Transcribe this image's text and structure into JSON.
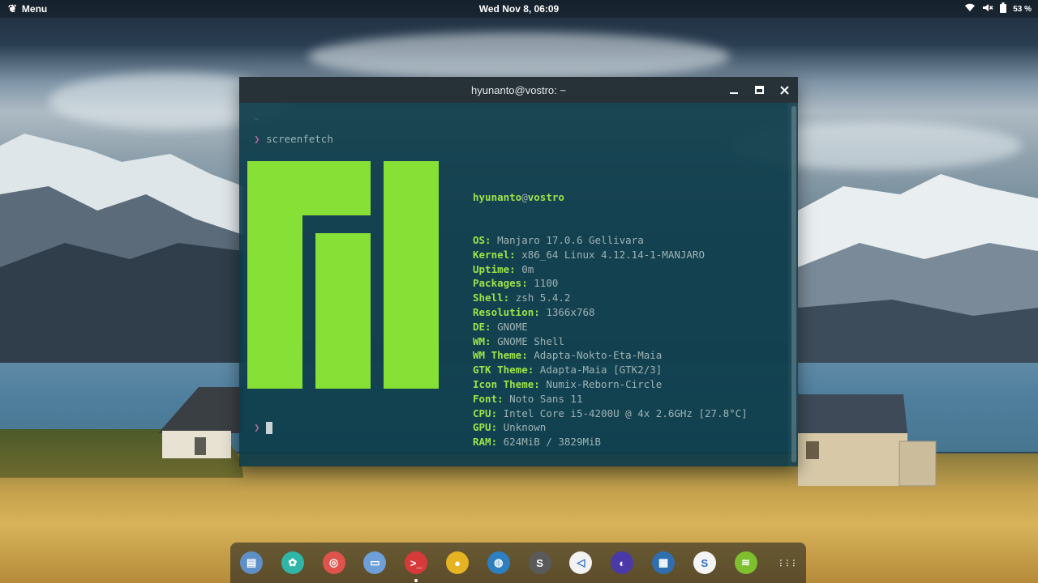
{
  "topbar": {
    "menu_label": "Menu",
    "clock": "Wed Nov  8, 06:09",
    "battery": "53 %"
  },
  "terminal": {
    "title": "hyunanto@vostro: ~",
    "tilde": "~",
    "command": "screenfetch",
    "user": "hyunanto",
    "at": "@",
    "host": "vostro",
    "info": [
      {
        "key": "OS:",
        "value": "Manjaro 17.0.6 Gellivara"
      },
      {
        "key": "Kernel:",
        "value": "x86_64 Linux 4.12.14-1-MANJARO"
      },
      {
        "key": "Uptime:",
        "value": "0m"
      },
      {
        "key": "Packages:",
        "value": "1100"
      },
      {
        "key": "Shell:",
        "value": "zsh 5.4.2"
      },
      {
        "key": "Resolution:",
        "value": "1366x768"
      },
      {
        "key": "DE:",
        "value": "GNOME"
      },
      {
        "key": "WM:",
        "value": "GNOME Shell"
      },
      {
        "key": "WM Theme:",
        "value": "Adapta-Nokto-Eta-Maia"
      },
      {
        "key": "GTK Theme:",
        "value": "Adapta-Maia [GTK2/3]"
      },
      {
        "key": "Icon Theme:",
        "value": "Numix-Reborn-Circle"
      },
      {
        "key": "Font:",
        "value": "Noto Sans 11"
      },
      {
        "key": "CPU:",
        "value": "Intel Core i5-4200U @ 4x 2.6GHz [27.8°C]"
      },
      {
        "key": "GPU:",
        "value": "Unknown"
      },
      {
        "key": "RAM:",
        "value": "624MiB / 3829MiB"
      }
    ],
    "prompt_symbol": "❯"
  },
  "dock": {
    "apps": [
      {
        "name": "files-icon",
        "color": "#5f8fc9",
        "glyph": "▤"
      },
      {
        "name": "software-icon",
        "color": "#2fb6a7",
        "glyph": "✿"
      },
      {
        "name": "screenshot-icon",
        "color": "#e0534c",
        "glyph": "◎"
      },
      {
        "name": "display-icon",
        "color": "#6e9fd8",
        "glyph": "▭"
      },
      {
        "name": "terminal-app-icon",
        "color": "#d73a3a",
        "glyph": ">_"
      },
      {
        "name": "chrome-icon",
        "color": "#e6b422",
        "glyph": "●"
      },
      {
        "name": "globe-icon",
        "color": "#2d7fc1",
        "glyph": "◍"
      },
      {
        "name": "sublime-icon",
        "color": "#5a5a5a",
        "glyph": "S"
      },
      {
        "name": "vscode-icon",
        "color": "#f2f2f2",
        "glyph": "◁"
      },
      {
        "name": "moon-icon",
        "color": "#4a3aa8",
        "glyph": "◐"
      },
      {
        "name": "system-monitor-icon",
        "color": "#2f6fb0",
        "glyph": "▦"
      },
      {
        "name": "slack-icon",
        "color": "#f4f4f4",
        "glyph": "S"
      },
      {
        "name": "spotify-icon",
        "color": "#7dbf2e",
        "glyph": "≋"
      },
      {
        "name": "app-grid-icon",
        "color": "transparent",
        "glyph": "⋮⋮⋮"
      }
    ]
  }
}
